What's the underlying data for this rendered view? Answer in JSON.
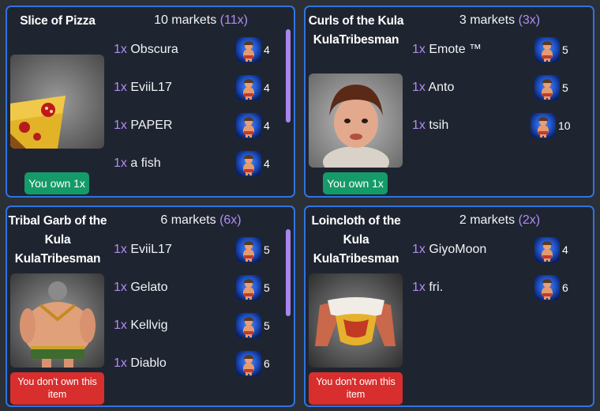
{
  "cards": [
    {
      "title": "Slice of Pizza",
      "image": "pizza-slice-icon",
      "markets_text": "10 markets",
      "markets_mult": "(11x)",
      "badge": "You own 1x",
      "owned": true,
      "rows": [
        {
          "qty": "1x",
          "seller": "Obscura",
          "level": "4",
          "avatar": "kula-avatar-icon"
        },
        {
          "qty": "1x",
          "seller": "EviiL17",
          "level": "4",
          "avatar": "kula-avatar-icon"
        },
        {
          "qty": "1x",
          "seller": "PAPER",
          "level": "4",
          "avatar": "kula-avatar-icon"
        },
        {
          "qty": "1x",
          "seller": "a fish",
          "level": "4",
          "avatar": "kula-avatar-icon"
        }
      ]
    },
    {
      "title": "Curls of the Kula KulaTribesman",
      "image": "curly-hair-icon",
      "markets_text": "3 markets",
      "markets_mult": "(3x)",
      "badge": "You own 1x",
      "owned": true,
      "rows": [
        {
          "qty": "1x",
          "seller": "Emote ™",
          "level": "5",
          "avatar": "kula-avatar-icon"
        },
        {
          "qty": "1x",
          "seller": "Anto",
          "level": "5",
          "avatar": "kula-avatar-icon"
        },
        {
          "qty": "1x",
          "seller": "tsih",
          "level": "10",
          "avatar": "kula-avatar-icon"
        }
      ]
    },
    {
      "title": "Tribal Garb of the Kula KulaTribesman",
      "image": "tribal-garb-icon",
      "markets_text": "6 markets",
      "markets_mult": "(6x)",
      "badge": "You don't own this item",
      "owned": false,
      "rows": [
        {
          "qty": "1x",
          "seller": "EviiL17",
          "level": "5",
          "avatar": "kula-avatar-icon"
        },
        {
          "qty": "1x",
          "seller": "Gelato",
          "level": "5",
          "avatar": "kula-avatar-icon"
        },
        {
          "qty": "1x",
          "seller": "Kellvig",
          "level": "5",
          "avatar": "kula-avatar-icon"
        },
        {
          "qty": "1x",
          "seller": "Diablo",
          "level": "6",
          "avatar": "kula-avatar-icon"
        }
      ]
    },
    {
      "title": "Loincloth of the Kula KulaTribesman",
      "image": "loincloth-icon",
      "markets_text": "2 markets",
      "markets_mult": "(2x)",
      "badge": "You don't own this item",
      "owned": false,
      "rows": [
        {
          "qty": "1x",
          "seller": "GiyoMoon",
          "level": "4",
          "avatar": "kula-avatar-icon"
        },
        {
          "qty": "1x",
          "seller": "fri.",
          "level": "6",
          "avatar": "kula-avatar-icon"
        }
      ]
    }
  ],
  "colors": {
    "card_border": "#2f74e0",
    "card_bg": "#1f2530",
    "owned_badge": "#159a6a",
    "not_owned_badge": "#d82e2e",
    "multiplier": "#b18cf5"
  }
}
